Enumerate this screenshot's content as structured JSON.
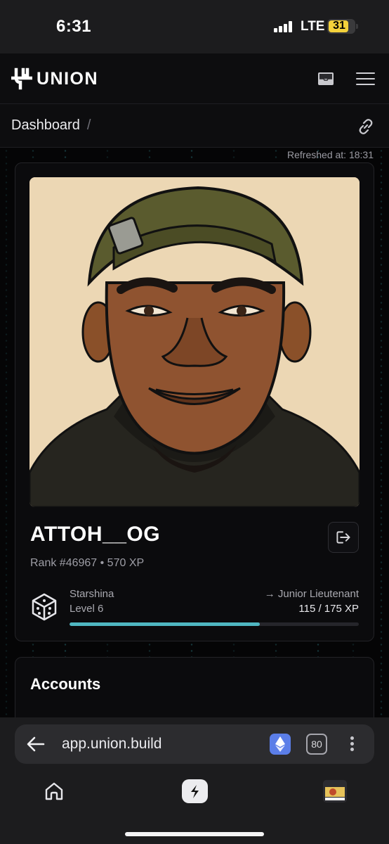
{
  "status_bar": {
    "time": "6:31",
    "network": "LTE",
    "battery": "31"
  },
  "header": {
    "logo_text": "UNION",
    "icons": {
      "inbox": "inbox-icon",
      "menu": "hamburger-menu-icon",
      "link": "link-icon"
    }
  },
  "breadcrumb": {
    "current": "Dashboard",
    "separator": "/"
  },
  "refreshed_label": "Refreshed at: 18:31",
  "profile": {
    "username": "ATTOH__OG",
    "rank_line": "Rank #46967 • 570 XP",
    "level_name": "Starshina",
    "level_label": "Level 6",
    "next_level": "→ Junior Lieutenant",
    "xp_progress": "115 / 175 XP",
    "progress_fraction": 0.657
  },
  "accounts": {
    "title": "Accounts"
  },
  "browser": {
    "url": "app.union.build",
    "tab_count": "80"
  },
  "colors": {
    "accent": "#4fb6c1",
    "background": "#000000",
    "card": "#0b0b0d",
    "eth_button": "#5b7ee8"
  }
}
